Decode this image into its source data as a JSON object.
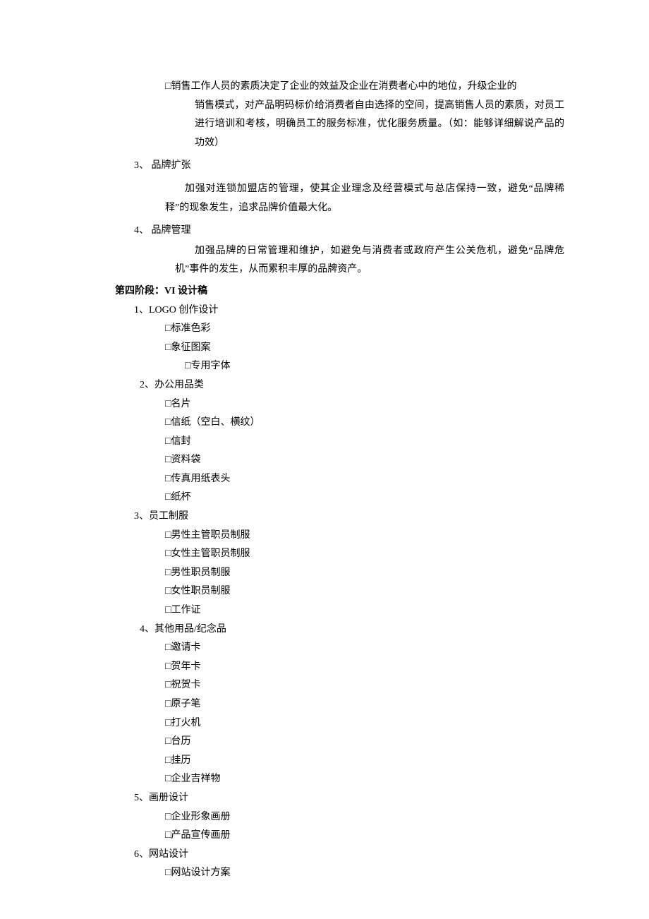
{
  "intro": {
    "bullet": "□",
    "first_line": "销售工作人员的素质决定了企业的效益及企业在消费者心中的地位，升级企业的",
    "rest": "销售模式，对产品明码标价给消费者自由选择的空间，提高销售人员的素质，对员工进行培训和考核，明确员工的服务标准，优化服务质量。（如：能够详细解说产品的功效）"
  },
  "sec3": {
    "title": "3、 品牌扩张",
    "body": "加强对连锁加盟店的管理，使其企业理念及经营模式与总店保持一致，避免“品牌稀释”的现象发生，追求品牌价值最大化。"
  },
  "sec4": {
    "title": "4、 品牌管理",
    "body": "加强品牌的日常管理和维护，如避免与消费者或政府产生公关危机，避免“品牌危机”事件的发生，从而累积丰厚的品牌资产。"
  },
  "stage4_heading": "第四阶段：VI 设计稿",
  "vi": {
    "s1": {
      "title": "1、LOGO 创作设计",
      "items": [
        "□标准色彩",
        "□象征图案",
        "□专用字体"
      ]
    },
    "s2": {
      "title": "2、办公用品类",
      "items": [
        "□名片",
        "□信纸（空白、横纹）",
        "□信封",
        "□资料袋",
        "□传真用纸表头",
        "□纸杯"
      ]
    },
    "s3": {
      "title": "3、员工制服",
      "items": [
        "□男性主管职员制服",
        "□女性主管职员制服",
        "□男性职员制服",
        "□女性职员制服",
        "□工作证"
      ]
    },
    "s4": {
      "title": "4、其他用品/纪念品",
      "items": [
        "□邀请卡",
        "□贺年卡",
        "□祝贺卡",
        "□原子笔",
        "□打火机",
        "□台历",
        "□挂历",
        "□企业吉祥物"
      ]
    },
    "s5": {
      "title": "5、画册设计",
      "items": [
        "□企业形象画册",
        "□产品宣传画册"
      ]
    },
    "s6": {
      "title": "6、网站设计",
      "items": [
        "□网站设计方案"
      ]
    }
  }
}
